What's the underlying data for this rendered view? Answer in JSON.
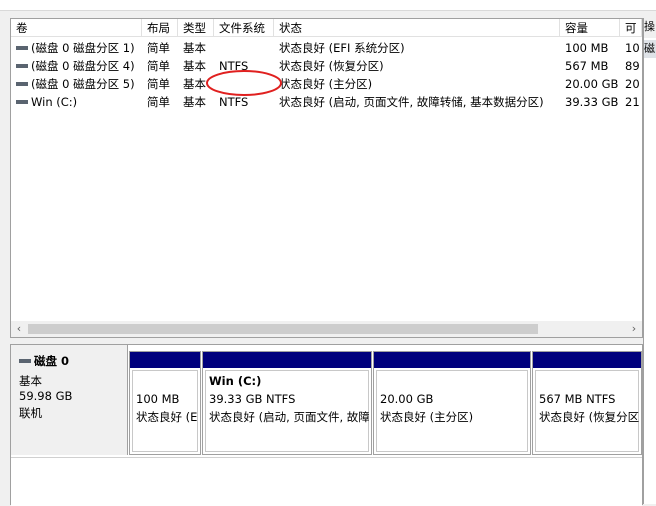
{
  "columns": [
    "卷",
    "布局",
    "类型",
    "文件系统",
    "状态",
    "容量",
    "可"
  ],
  "volumes": [
    {
      "name": "(磁盘 0 磁盘分区 1)",
      "layout": "简单",
      "type": "基本",
      "fs": "",
      "status": "状态良好 (EFI 系统分区)",
      "capacity": "100 MB",
      "free": "10"
    },
    {
      "name": "(磁盘 0 磁盘分区 4)",
      "layout": "简单",
      "type": "基本",
      "fs": "NTFS",
      "status": "状态良好 (恢复分区)",
      "capacity": "567 MB",
      "free": "89"
    },
    {
      "name": "(磁盘 0 磁盘分区 5)",
      "layout": "简单",
      "type": "基本",
      "fs": "",
      "status": "状态良好 (主分区)",
      "capacity": "20.00 GB",
      "free": "20"
    },
    {
      "name": "Win (C:)",
      "layout": "简单",
      "type": "基本",
      "fs": "NTFS",
      "status": "状态良好 (启动, 页面文件, 故障转储, 基本数据分区)",
      "capacity": "39.33 GB",
      "free": "21"
    }
  ],
  "scroll": {
    "left": "‹",
    "right": "›"
  },
  "side_tab": {
    "top": "操",
    "sub": "磁"
  },
  "disk": {
    "name": "磁盘 0",
    "kind": "基本",
    "size": "59.98 GB",
    "state": "联机"
  },
  "partitions": [
    {
      "title": "",
      "size": "100 MB",
      "status": "状态良好 (EFI 系统分区)"
    },
    {
      "title": "Win  (C:)",
      "size": "39.33 GB NTFS",
      "status": "状态良好 (启动, 页面文件, 故障转储, 基本数据分区)"
    },
    {
      "title": "",
      "size": "20.00 GB",
      "status": "状态良好 (主分区)"
    },
    {
      "title": "",
      "size": "567 MB NTFS",
      "status": "状态良好 (恢复分区)"
    }
  ],
  "colors": {
    "partition_bar": "#00007d",
    "annotation": "#e0201f"
  }
}
